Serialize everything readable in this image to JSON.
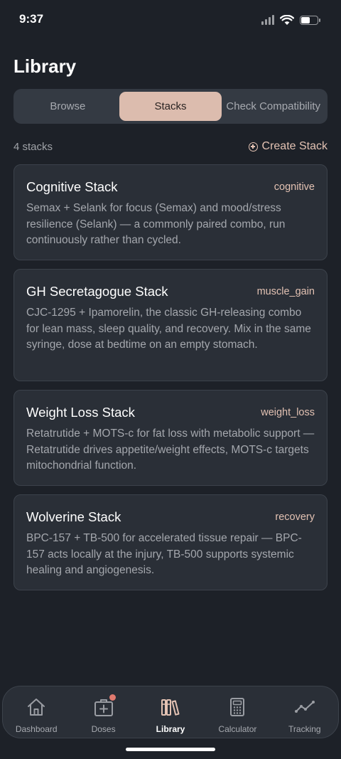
{
  "status_bar": {
    "time": "9:37"
  },
  "page": {
    "title": "Library"
  },
  "segmented_control": {
    "options": [
      {
        "label": "Browse",
        "selected": false
      },
      {
        "label": "Stacks",
        "selected": true
      },
      {
        "label": "Check Compatibility",
        "selected": false
      }
    ]
  },
  "list_header": {
    "count_text": "4 stacks",
    "create_label": "Create Stack"
  },
  "stacks": [
    {
      "title": "Cognitive Stack",
      "tag": "cognitive",
      "description": "Semax + Selank for focus (Semax) and mood/stress resilience (Selank) — a commonly paired combo, run continuously rather than cycled."
    },
    {
      "title": "GH Secretagogue Stack",
      "tag": "muscle_gain",
      "description": "CJC-1295 + Ipamorelin, the classic GH-releasing combo for lean mass, sleep quality, and recovery. Mix in the same syringe, dose at bedtime on an empty stomach."
    },
    {
      "title": "Weight Loss Stack",
      "tag": "weight_loss",
      "description": "Retatrutide + MOTS-c for fat loss with metabolic support — Retatrutide drives appetite/weight effects, MOTS-c targets mitochondrial function."
    },
    {
      "title": "Wolverine Stack",
      "tag": "recovery",
      "description": "BPC-157 + TB-500 for accelerated tissue repair — BPC-157 acts locally at the injury, TB-500 supports systemic healing and angiogenesis."
    }
  ],
  "tab_bar": {
    "items": [
      {
        "label": "Dashboard",
        "icon": "home-icon",
        "active": false
      },
      {
        "label": "Doses",
        "icon": "medical-kit-icon",
        "active": false,
        "badge": true
      },
      {
        "label": "Library",
        "icon": "library-icon",
        "active": true
      },
      {
        "label": "Calculator",
        "icon": "calculator-icon",
        "active": false
      },
      {
        "label": "Tracking",
        "icon": "trend-line-icon",
        "active": false
      }
    ]
  },
  "colors": {
    "background": "#1d2128",
    "card": "#2a2f37",
    "accent": "#e3c2b3",
    "segment_active": "#dcbcae",
    "badge": "#e07a6f"
  }
}
